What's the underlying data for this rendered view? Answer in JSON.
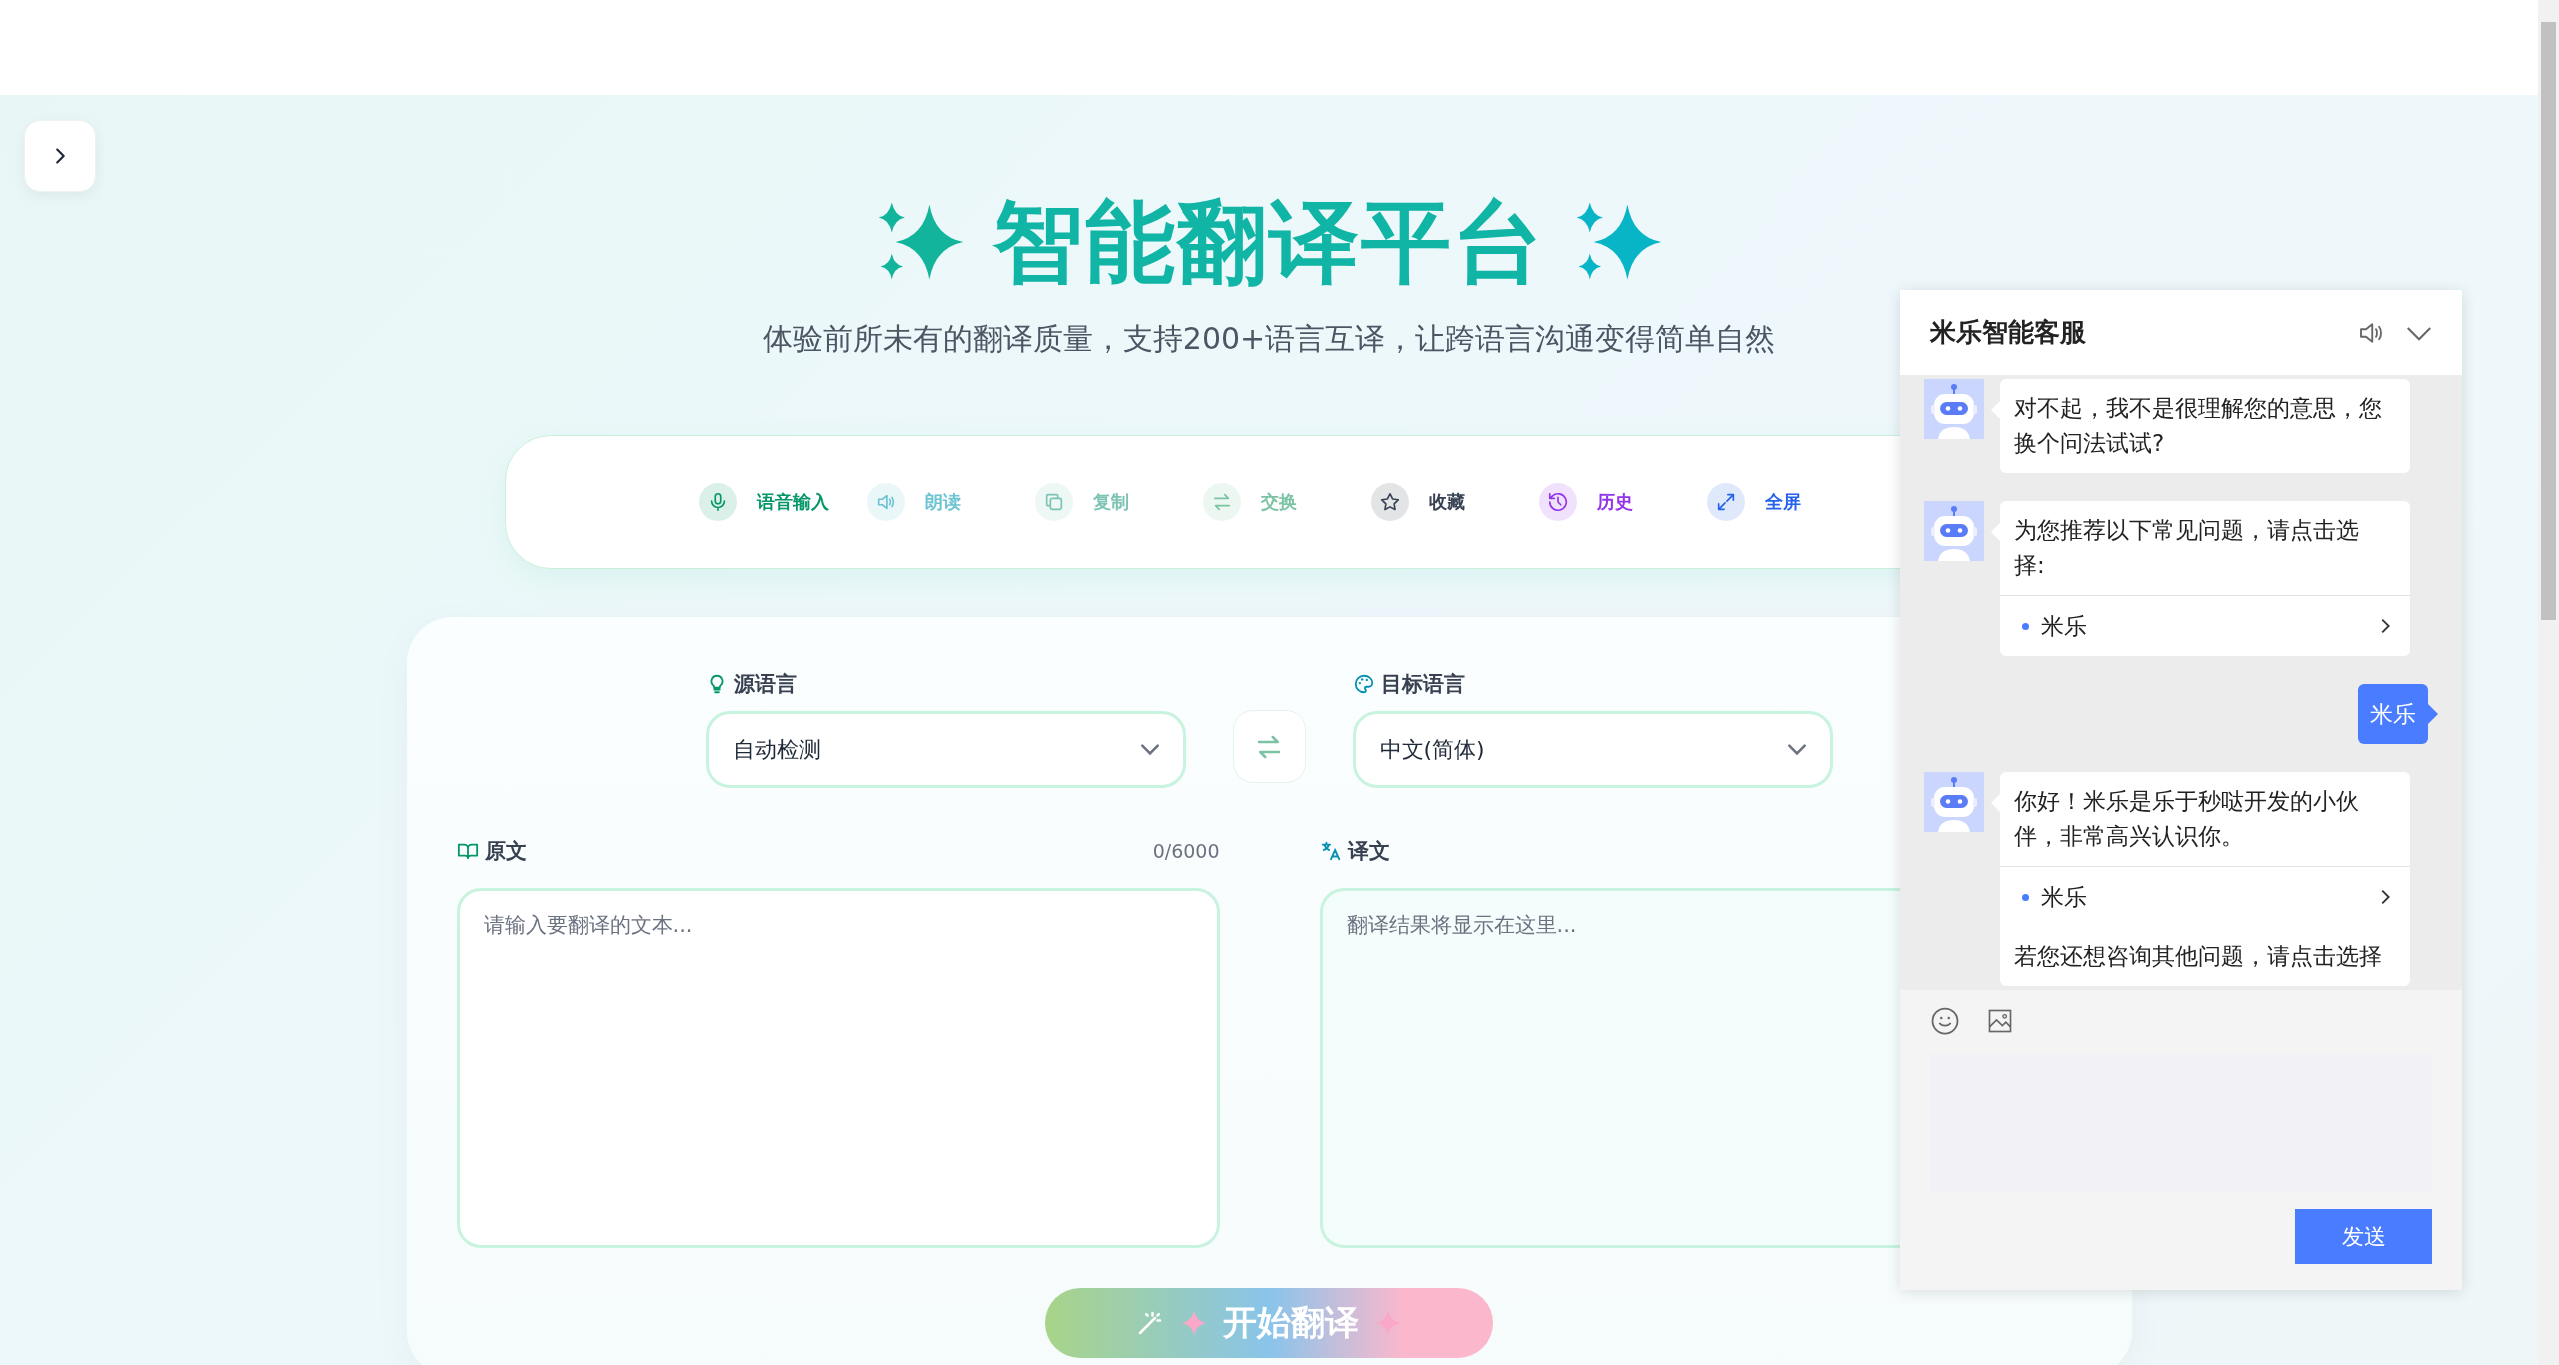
{
  "header": {
    "title": "智能翻译平台",
    "subtitle": "体验前所未有的翻译质量，支持200+语言互译，让跨语言沟通变得简单自然"
  },
  "toolbar": [
    {
      "kind": "mic",
      "label": "语音输入",
      "color": "#059669"
    },
    {
      "kind": "speaker",
      "label": "朗读",
      "color": "#6cc3d3"
    },
    {
      "kind": "copy",
      "label": "复制",
      "color": "#7cc3b4"
    },
    {
      "kind": "swap",
      "label": "交换",
      "color": "#7cc3a4"
    },
    {
      "kind": "star",
      "label": "收藏",
      "color": "#374151"
    },
    {
      "kind": "history",
      "label": "历史",
      "color": "#9333ea"
    },
    {
      "kind": "expand",
      "label": "全屏",
      "color": "#2563eb"
    }
  ],
  "languages": {
    "source": {
      "label": "源语言",
      "value": "自动检测"
    },
    "target": {
      "label": "目标语言",
      "value": "中文(简体)"
    }
  },
  "source_panel": {
    "label": "原文",
    "counter": "0/6000",
    "placeholder": "请输入要翻译的文本..."
  },
  "target_panel": {
    "label": "译文",
    "placeholder": "翻译结果将显示在这里..."
  },
  "translate_button": {
    "label": "开始翻译"
  },
  "chat": {
    "title": "米乐智能客服",
    "messages": [
      {
        "kind": "bot",
        "text": "对不起，我不是很理解您的意思，您换个问法试试?"
      },
      {
        "kind": "bot",
        "text": "为您推荐以下常见问题，请点击选择:",
        "options": [
          "米乐"
        ]
      },
      {
        "kind": "user",
        "text": "米乐"
      },
      {
        "kind": "bot",
        "text": "你好！米乐是乐于秒哒开发的小伙伴，非常高兴认识你。",
        "options": [
          "米乐"
        ],
        "note": "若您还想咨询其他问题，请点击选择"
      }
    ],
    "send_button": "发送"
  }
}
